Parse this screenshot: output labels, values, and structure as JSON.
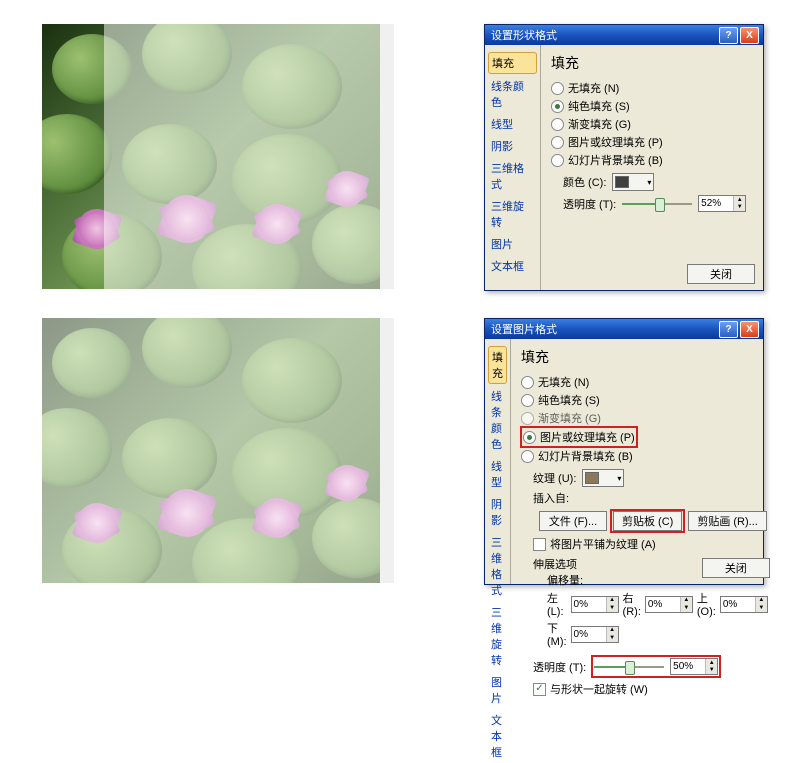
{
  "slides": {
    "overlay_partial_alpha": "0.52",
    "overlay_full_alpha": "0.50"
  },
  "dialog1": {
    "title": "设置形状格式",
    "help": "?",
    "close": "X",
    "sidebar": [
      "填充",
      "线条颜色",
      "线型",
      "阴影",
      "三维格式",
      "三维旋转",
      "图片",
      "文本框"
    ],
    "heading": "填充",
    "options": {
      "none": "无填充 (N)",
      "solid": "纯色填充 (S)",
      "gradient": "渐变填充 (G)",
      "picture": "图片或纹理填充 (P)",
      "slidebg": "幻灯片背景填充 (B)"
    },
    "color_label": "颜色 (C):",
    "transparency_label": "透明度 (T):",
    "transparency_value": "52%",
    "close_btn": "关闭"
  },
  "dialog2": {
    "title": "设置图片格式",
    "help": "?",
    "close": "X",
    "sidebar": [
      "填充",
      "线条颜色",
      "线型",
      "阴影",
      "三维格式",
      "三维旋转",
      "图片",
      "文本框"
    ],
    "heading": "填充",
    "options": {
      "none": "无填充 (N)",
      "solid": "纯色填充 (S)",
      "gradient": "渐变填充 (G)",
      "picture": "图片或纹理填充 (P)",
      "slidebg": "幻灯片背景填充 (B)"
    },
    "texture_label": "纹理 (U):",
    "insert_from": "插入自:",
    "file_btn": "文件 (F)...",
    "clipboard_btn": "剪贴板 (C)",
    "clipart_btn": "剪贴画 (R)...",
    "tile_check": "将图片平铺为纹理 (A)",
    "stretch_label": "伸展选项",
    "offset_label": "偏移量:",
    "left": "左 (L):",
    "right": "右 (R):",
    "top": "上 (O):",
    "bottom": "下 (M):",
    "zero": "0%",
    "transparency_label": "透明度 (T):",
    "transparency_value": "50%",
    "rotate_check": "与形状一起旋转 (W)",
    "close_btn": "关闭"
  }
}
